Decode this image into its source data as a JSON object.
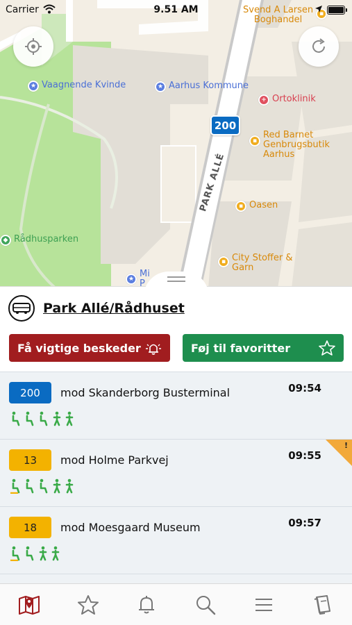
{
  "status_bar": {
    "carrier": "Carrier",
    "time": "9.51 AM"
  },
  "map": {
    "pois": [
      {
        "label": "Svend A Larsen\nBoghandel",
        "type": "shop"
      },
      {
        "label": "Vaagnende Kvinde",
        "type": "landmark"
      },
      {
        "label": "Aarhus Kommune",
        "type": "landmark"
      },
      {
        "label": "Ortoklinik",
        "type": "health"
      },
      {
        "label": "Red Barnet\nGenbrugsbutik\nAarhus",
        "type": "shop"
      },
      {
        "label": "Oasen",
        "type": "shop"
      },
      {
        "label": "Rådhusparken",
        "type": "park"
      },
      {
        "label": "City Stoffer &\nGarn",
        "type": "shop"
      },
      {
        "label": "Mi\nP",
        "type": "landmark"
      }
    ],
    "street": "PARK ALLÉ",
    "route_marker": "200",
    "locate_button_icon": "crosshair-icon",
    "refresh_button_icon": "refresh-icon"
  },
  "stop": {
    "name": "Park Allé/Rådhuset",
    "icon": "bus-icon",
    "alert_button": "Få vigtige beskeder",
    "favorite_button": "Føj til favoritter"
  },
  "departures": [
    {
      "line": "200",
      "color": "blue",
      "destination": "mod Skanderborg Busterminal",
      "time": "09:54",
      "occupancy": [
        "seat",
        "seat",
        "seat",
        "stand",
        "stand"
      ],
      "warning": false
    },
    {
      "line": "13",
      "color": "yellow",
      "destination": "mod Holme Parkvej",
      "time": "09:55",
      "occupancy": [
        "seat-yellow",
        "seat",
        "seat",
        "stand",
        "stand"
      ],
      "warning": true
    },
    {
      "line": "18",
      "color": "yellow",
      "destination": "mod Moesgaard Museum",
      "time": "09:57",
      "occupancy": [
        "seat-yellow",
        "seat",
        "stand",
        "stand"
      ],
      "warning": false
    }
  ],
  "tabs": [
    {
      "name": "map-tab",
      "icon": "map-pin-icon",
      "active": true
    },
    {
      "name": "favorites-tab",
      "icon": "star-icon",
      "active": false
    },
    {
      "name": "alerts-tab",
      "icon": "bell-icon",
      "active": false
    },
    {
      "name": "search-tab",
      "icon": "search-icon",
      "active": false
    },
    {
      "name": "menu-tab",
      "icon": "menu-icon",
      "active": false
    },
    {
      "name": "tickets-tab",
      "icon": "ticket-icon",
      "active": false
    }
  ],
  "colors": {
    "brand_red": "#a11d1f",
    "fav_green": "#1e8e4e",
    "line_blue": "#0a6bc2",
    "line_yellow": "#f3b200",
    "occupancy_green": "#3aaa48"
  }
}
